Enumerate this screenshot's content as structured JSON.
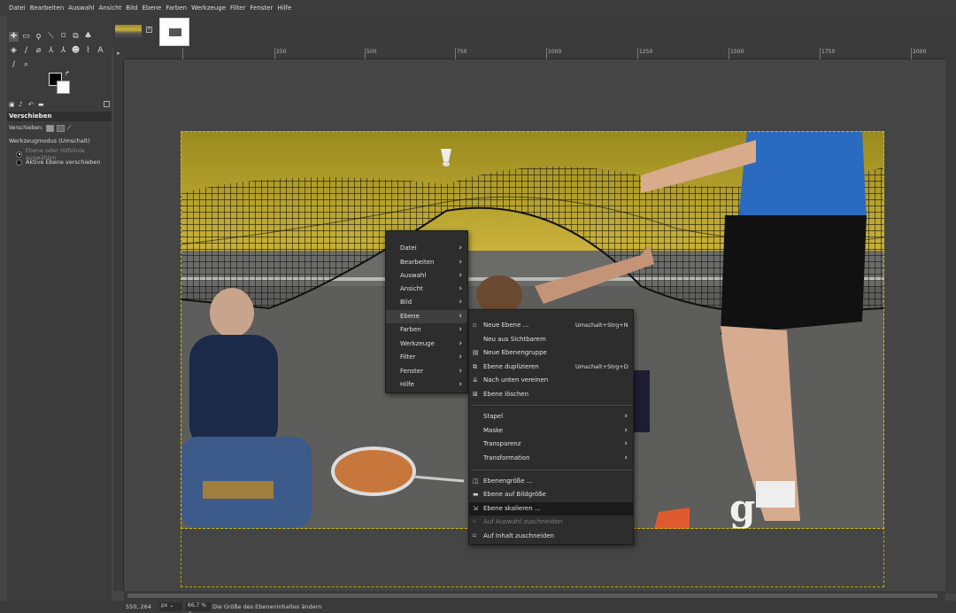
{
  "menubar": [
    "Datei",
    "Bearbeiten",
    "Auswahl",
    "Ansicht",
    "Bild",
    "Ebene",
    "Farben",
    "Werkzeuge",
    "Filter",
    "Fenster",
    "Hilfe"
  ],
  "tool_options": {
    "title": "Verschieben",
    "move_label": "Verschieben:",
    "mode_label": "Werkzeugmodus (Umschalt)",
    "option1": "Ebene oder Hilfslinie auswählen",
    "option2": "Aktive Ebene verschieben"
  },
  "ruler_labels": [
    "250",
    "500",
    "750",
    "1000",
    "1250",
    "1500",
    "1750",
    "2000"
  ],
  "status": {
    "coords": "550, 264",
    "unit": "px",
    "zoom": "66.7 %",
    "message": "Die Größe des Ebeneninhaltes ändern"
  },
  "context_menu": {
    "items": [
      "Datei",
      "Bearbeiten",
      "Auswahl",
      "Ansicht",
      "Bild",
      "Ebene",
      "Farben",
      "Werkzeuge",
      "Filter",
      "Fenster",
      "Hilfe"
    ],
    "active": "Ebene"
  },
  "ebene_menu": {
    "group1": [
      {
        "label": "Neue Ebene ...",
        "shortcut": "Umschalt+Strg+N"
      },
      {
        "label": "Neu aus Sichtbarem",
        "shortcut": ""
      },
      {
        "label": "Neue Ebenengruppe",
        "shortcut": ""
      },
      {
        "label": "Ebene duplizieren",
        "shortcut": "Umschalt+Strg+D"
      },
      {
        "label": "Nach unten vereinen",
        "shortcut": ""
      },
      {
        "label": "Ebene löschen",
        "shortcut": ""
      }
    ],
    "group2": [
      "Stapel",
      "Maske",
      "Transparenz",
      "Transformation"
    ],
    "group3": [
      {
        "label": "Ebenengröße ...",
        "disabled": false
      },
      {
        "label": "Ebene auf Bildgröße",
        "disabled": false
      },
      {
        "label": "Ebene skalieren ...",
        "disabled": false,
        "highlighted": true
      },
      {
        "label": "Auf Auswahl zuschneiden",
        "disabled": true
      },
      {
        "label": "Auf Inhalt zuschneiden",
        "disabled": false
      }
    ]
  },
  "colors": {
    "menu_bg": "#2d2d2d",
    "highlight": "#1a1a1a",
    "selection": "#d4c200"
  }
}
